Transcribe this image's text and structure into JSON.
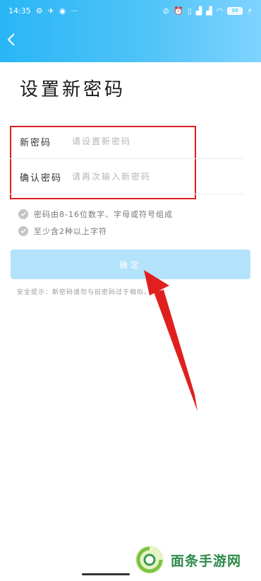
{
  "status_bar": {
    "time": "14:35",
    "more": "···",
    "battery": "88"
  },
  "page": {
    "title": "设置新密码"
  },
  "form": {
    "new_password": {
      "label": "新密码",
      "placeholder": "请设置新密码",
      "value": ""
    },
    "confirm_password": {
      "label": "确认密码",
      "placeholder": "请再次输入新密码",
      "value": ""
    }
  },
  "rules": [
    {
      "text": "密码由8-16位数字、字母或符号组成"
    },
    {
      "text": "至少含2种以上字符"
    }
  ],
  "confirm_button": {
    "label": "确定"
  },
  "security_tip": "安全提示：新密码请勿与旧密码过于相似。",
  "watermark": {
    "text": "面条手游网"
  },
  "colors": {
    "header_start": "#29b6f6",
    "header_end": "#7fd3ff",
    "button_disabled": "#b3e2fb",
    "highlight_red": "#e0201f",
    "watermark_green": "#2c8a4a"
  }
}
